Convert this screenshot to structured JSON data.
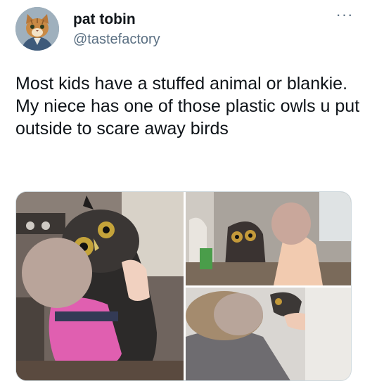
{
  "author": {
    "name": "pat tobin",
    "handle": "@tastefactory",
    "avatar_icon": "cat-avatar-icon"
  },
  "menu": {
    "label": "···",
    "icon": "more-options-icon"
  },
  "tweet": {
    "text": "Most kids have a stuffed animal or blankie. My niece has one of those plastic owls u put outside to scare away birds"
  },
  "media": {
    "photos": [
      {
        "subject": "child-hugging-owl"
      },
      {
        "subject": "child-with-owl-at-table"
      },
      {
        "subject": "child-lying-with-owl"
      }
    ]
  },
  "colors": {
    "text": "#0f1419",
    "secondary": "#5b7083",
    "border": "#cfd9de"
  }
}
